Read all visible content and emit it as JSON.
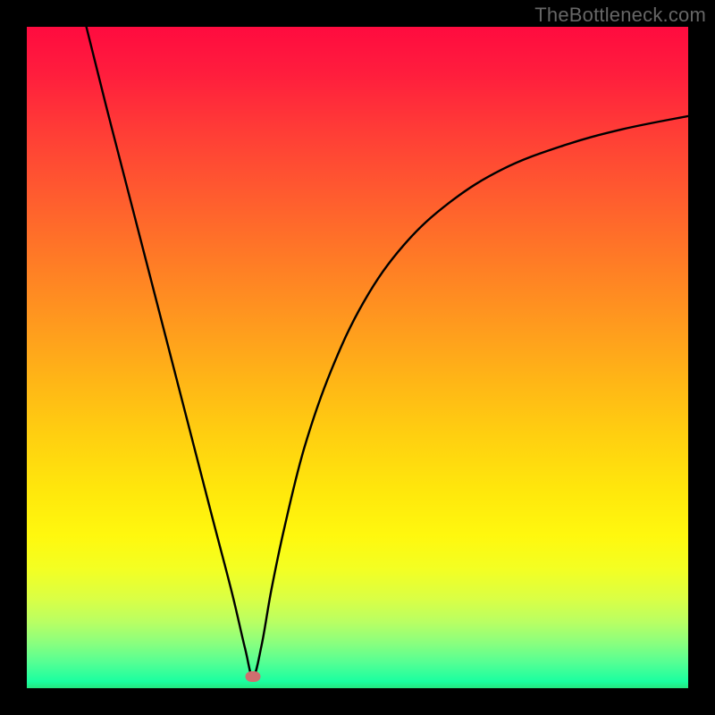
{
  "watermark": "TheBottleneck.com",
  "curve_color": "#000000",
  "curve_width": 2.4,
  "marker_color": "#cf6f6f",
  "minimum": {
    "x_pct": 34.2,
    "y_pct": 98.2
  },
  "gradient_colors": {
    "top": "#ff0b3f",
    "mid": "#ffd010",
    "bottom": "#24e67f"
  },
  "chart_data": {
    "type": "line",
    "title": "",
    "xlabel": "",
    "ylabel": "",
    "xlim": [
      0,
      100
    ],
    "ylim": [
      0,
      100
    ],
    "grid": false,
    "series": [
      {
        "name": "curve",
        "x": [
          9.0,
          12.0,
          16.0,
          20.0,
          24.0,
          28.0,
          31.0,
          33.0,
          34.2,
          35.5,
          37.0,
          39.0,
          42.0,
          46.0,
          51.0,
          57.0,
          64.0,
          72.0,
          81.0,
          90.0,
          100.0
        ],
        "y": [
          100.0,
          88.0,
          72.5,
          57.0,
          41.5,
          26.0,
          14.5,
          6.0,
          1.8,
          6.5,
          15.0,
          24.5,
          36.5,
          48.0,
          58.5,
          67.0,
          73.5,
          78.5,
          82.0,
          84.5,
          86.5
        ]
      }
    ],
    "annotations": [
      {
        "type": "marker",
        "name": "minimum",
        "x": 34.2,
        "y": 1.8
      }
    ]
  }
}
